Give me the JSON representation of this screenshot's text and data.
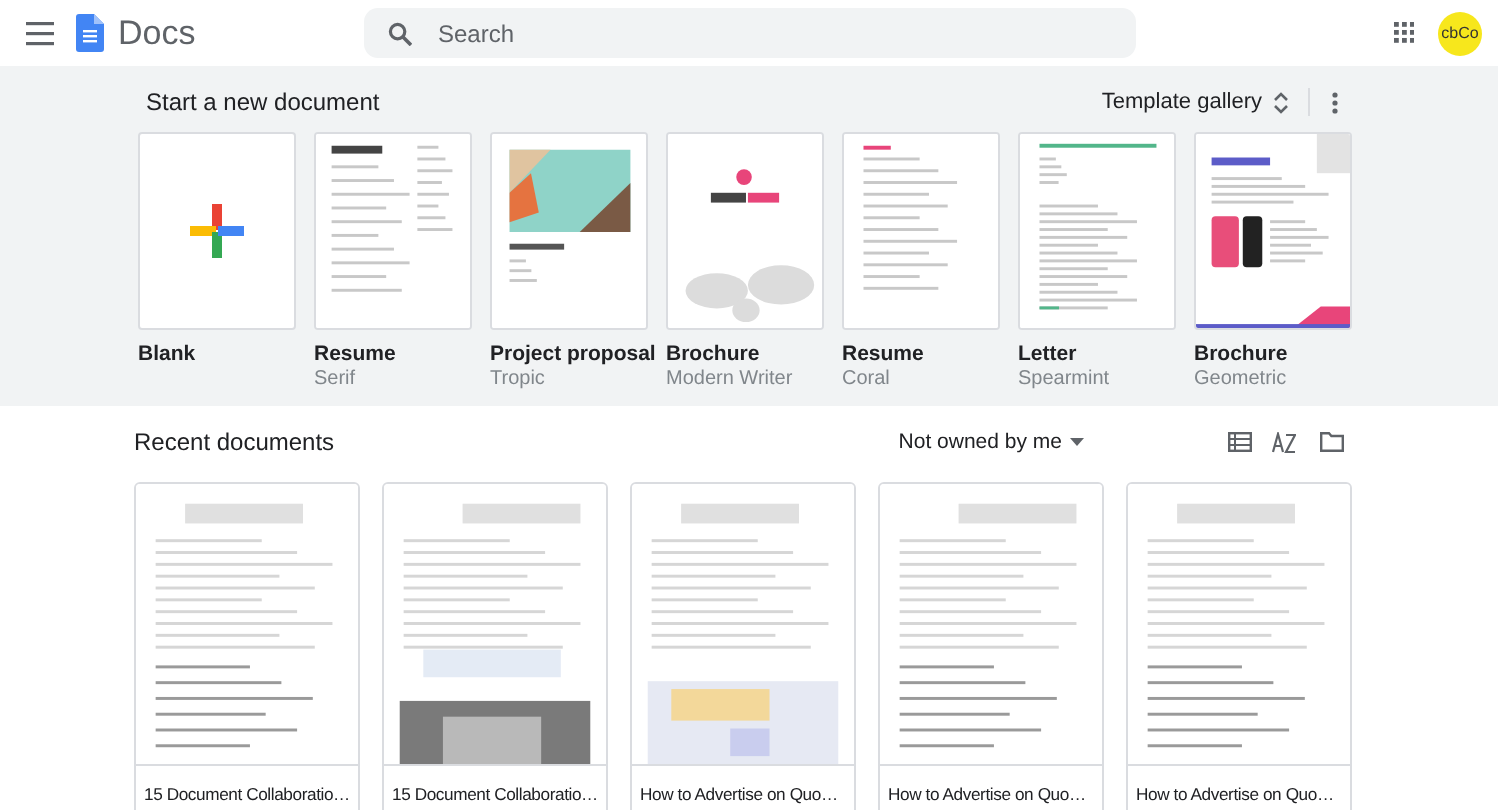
{
  "app": {
    "name": "Docs"
  },
  "search": {
    "placeholder": "Search"
  },
  "account": {
    "avatar": "cbCo"
  },
  "templates_section": {
    "title": "Start a new document",
    "gallery_button": "Template gallery"
  },
  "templates": [
    {
      "kind": "blank",
      "name": "Blank"
    },
    {
      "kind": "picture",
      "name": "Resume",
      "style": "Serif"
    },
    {
      "kind": "picture",
      "name": "Project proposal",
      "style": "Tropic"
    },
    {
      "kind": "picture",
      "name": "Brochure",
      "style": "Modern Writer"
    },
    {
      "kind": "picture",
      "name": "Resume",
      "style": "Coral"
    },
    {
      "kind": "picture",
      "name": "Letter",
      "style": "Spearmint"
    },
    {
      "kind": "picture",
      "name": "Brochure",
      "style": "Geometric"
    }
  ],
  "recent_section": {
    "title": "Recent documents",
    "owner_filter": "Not owned by me"
  },
  "documents": [
    {
      "kind": "picture",
      "title": "15 Document Collaboratio…"
    },
    {
      "kind": "picture",
      "title": "15 Document Collaboratio…"
    },
    {
      "kind": "picture",
      "title": "How to Advertise on Quo…"
    },
    {
      "kind": "picture",
      "title": "How to Advertise on Quo…"
    },
    {
      "kind": "picture",
      "title": "How to Advertise on Quo…"
    }
  ]
}
